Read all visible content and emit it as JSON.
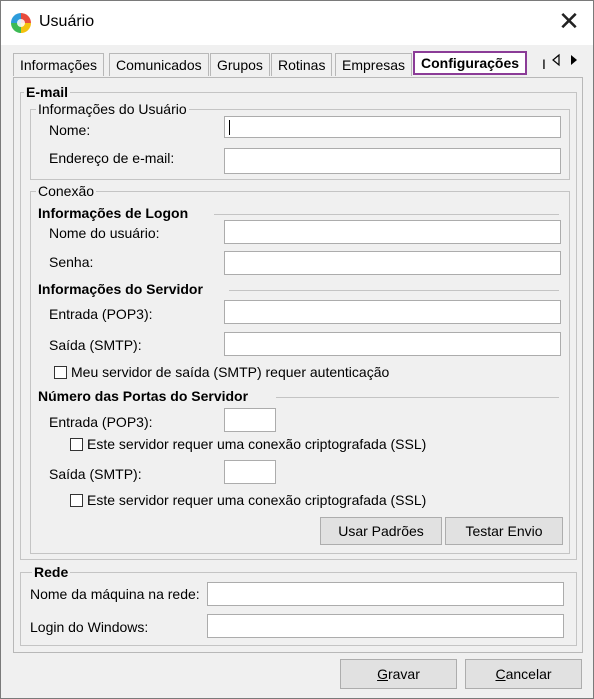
{
  "window": {
    "title": "Usuário",
    "close": "✕"
  },
  "tabs": [
    "Informações",
    "Comunicados",
    "Grupos",
    "Rotinas",
    "Empresas",
    "Configurações",
    "I"
  ],
  "email": {
    "title": "E-mail",
    "user_info": {
      "title": "Informações do Usuário",
      "name_label": "Nome:",
      "name_value": "",
      "email_label": "Endereço de e-mail:",
      "email_value": ""
    }
  },
  "connection": {
    "title": "Conexão",
    "logon": {
      "title": "Informações de Logon",
      "user_label": "Nome do usuário:",
      "user_value": "",
      "pass_label": "Senha:",
      "pass_value": ""
    },
    "server": {
      "title": "Informações do Servidor",
      "incoming_label": "Entrada (POP3):",
      "incoming_value": "",
      "outgoing_label": "Saída (SMTP):",
      "outgoing_value": "",
      "auth_label": "Meu servidor de saída (SMTP) requer autenticação"
    },
    "ports": {
      "title": "Número das Portas do Servidor",
      "incoming_label": "Entrada (POP3):",
      "incoming_value": "",
      "incoming_ssl_label": "Este servidor requer uma conexão criptografada (SSL)",
      "outgoing_label": "Saída (SMTP):",
      "outgoing_value": "",
      "outgoing_ssl_label": "Este servidor requer uma conexão criptografada (SSL)"
    },
    "defaults_button": "Usar Padrões",
    "test_button": "Testar Envio"
  },
  "network": {
    "title": "Rede",
    "machine_label": "Nome da máquina na rede:",
    "machine_value": "",
    "windows_login_label": "Login do Windows:",
    "windows_login_value": ""
  },
  "footer": {
    "save_key": "G",
    "save_rest": "ravar",
    "cancel_key": "C",
    "cancel_rest": "ancelar"
  },
  "icons": {
    "app": "app-logo-icon",
    "close": "close-icon",
    "tab_left": "arrow-left-icon",
    "tab_right": "arrow-right-icon"
  },
  "colors": {
    "active_tab_border": "#8b3c97",
    "background": "#f0f0f0"
  }
}
